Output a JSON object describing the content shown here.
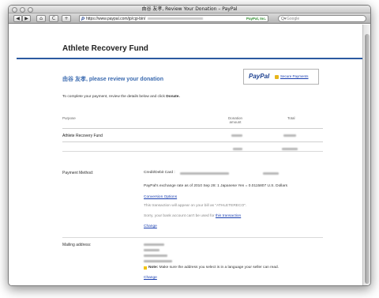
{
  "window": {
    "title": "由谷 友孝, Review Your Donation – PayPal"
  },
  "toolbar": {
    "back_label": "◀",
    "forward_label": "▶",
    "home_label": "⌂",
    "reload_label": "C",
    "add_label": "+",
    "url": "https://www.paypal.com/jp/cgi-bin/",
    "url_logo": "P",
    "secure_badge": "PayPal, Inc.",
    "search_placeholder": "Google",
    "search_glyph": "Q▾"
  },
  "page": {
    "site_title": "Athlete Recovery Fund",
    "review_heading": "由谷 友孝, please review your donation",
    "paypal_logo": "PayPal",
    "secure_payments": "Secure Payments",
    "instructions_prefix": "To complete your payment, review the details below and click ",
    "instructions_action": "Donate.",
    "table": {
      "col_purpose": "Purpose",
      "col_donation": "Donation amount",
      "col_total": "Total",
      "rows": [
        {
          "purpose": "Athlete Recovery Fund"
        }
      ]
    },
    "payment": {
      "label": "Payment Method:",
      "card_label": "Credit/Debit Card :",
      "exchange_rate": "PayPal's exchange rate as of 2010 Sep 28: 1 Japanese Yen = 0.0115807 U.S. Dollars",
      "conversion_options": "Conversion Options",
      "statement_note": "This transaction will appear on your bill as \"ATHLETERECO\".",
      "bank_note_prefix": "Sorry, your bank account can't be used for ",
      "bank_note_link": "this transaction",
      "change_label": "Change"
    },
    "mailing": {
      "label": "Mailing address:",
      "note_bold": "Note:",
      "note_text": " Make sure the address you select is in a language your seller can read.",
      "change_label": "Change"
    }
  },
  "colors": {
    "accent_blue": "#2c5aa0",
    "heading_blue": "#3a6ab0",
    "link_blue": "#1a3fb0",
    "note_yellow": "#f2c200"
  }
}
